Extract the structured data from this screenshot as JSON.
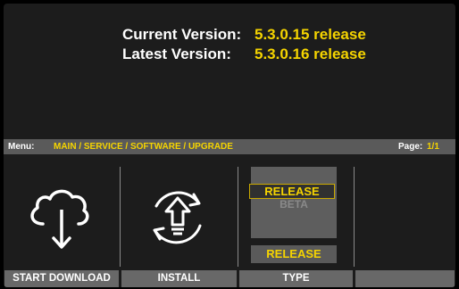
{
  "version_info": {
    "current_label": "Current Version:",
    "current_value": "5.3.0.15 release",
    "latest_label": "Latest Version:",
    "latest_value": "5.3.0.16 release"
  },
  "menu_bar": {
    "menu_label": "Menu:",
    "menu_path": "MAIN / SERVICE / SOFTWARE / UPGRADE",
    "page_label": "Page:",
    "page_value": "1/1"
  },
  "buttons": {
    "start_download": {
      "label": "START DOWNLOAD",
      "icon": "cloud-download-icon"
    },
    "install": {
      "label": "INSTALL",
      "icon": "install-cycle-icon"
    },
    "type": {
      "label": "TYPE",
      "options": [
        "RELEASE",
        "BETA"
      ],
      "highlighted_option": "RELEASE",
      "current_value": "RELEASE"
    },
    "empty": {
      "label": ""
    }
  },
  "colors": {
    "accent_yellow": "#f5d400",
    "panel_background": "#1c1c1c",
    "caption_background": "#686868",
    "menu_bar_background": "#5a5a5a"
  }
}
